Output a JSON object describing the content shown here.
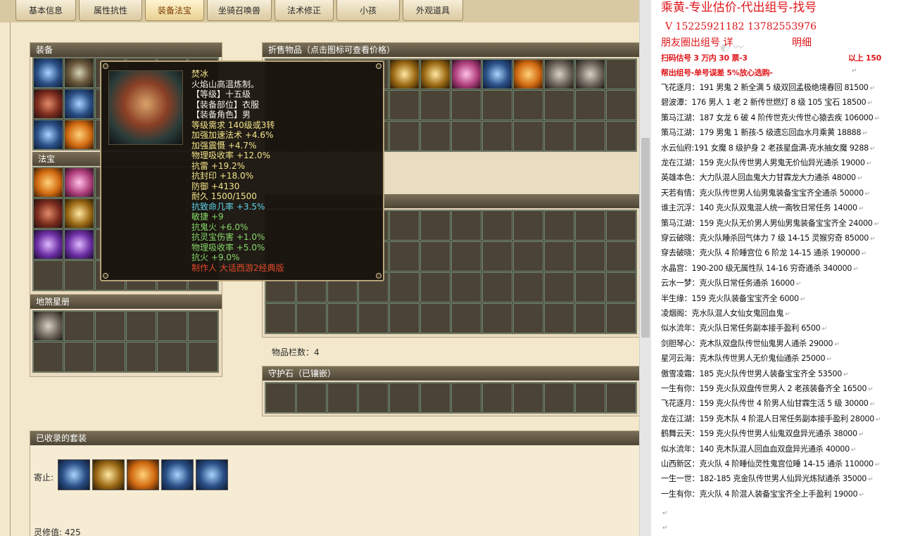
{
  "tabs": [
    {
      "label": "基本信息"
    },
    {
      "label": "属性抗性"
    },
    {
      "label": "装备法宝"
    },
    {
      "label": "坐骑召唤兽"
    },
    {
      "label": "法术修正"
    },
    {
      "label": "小孩"
    },
    {
      "label": "外观道具"
    }
  ],
  "active_tab": "装备法宝",
  "panels": {
    "equipment": "装备",
    "treasure": "法宝",
    "star_book": "地煞星册",
    "sell_items": "折售物品（点击图标可查看价格）",
    "guard_stone": "守护石（已镶嵌）",
    "collected_sets": "已收录的套装"
  },
  "item_slots_label": "物品栏数：4",
  "sets_row_label": "寄止:",
  "spirit_value_label": "灵修值:  425",
  "tooltip": {
    "lines": [
      {
        "text": "焚冰",
        "color": "y"
      },
      {
        "text": "火焰山高温炼制。",
        "color": "w"
      },
      {
        "text": "【等级】十五级",
        "color": "w"
      },
      {
        "text": "【装备部位】衣服",
        "color": "w"
      },
      {
        "text": "【装备角色】男",
        "color": "w"
      },
      {
        "text": "等级需求 140级或3转",
        "color": "y"
      },
      {
        "text": "加强加速法术 +4.6%",
        "color": "y"
      },
      {
        "text": "加强震慑 +4.7%",
        "color": "y"
      },
      {
        "text": "物理吸收率 +12.0%",
        "color": "y"
      },
      {
        "text": "抗雷 +19.2%",
        "color": "y"
      },
      {
        "text": "抗封印 +18.0%",
        "color": "y"
      },
      {
        "text": "防御 +4130",
        "color": "y"
      },
      {
        "text": "耐久 1500/1500",
        "color": "y"
      },
      {
        "text": "抗致命几率 +3.5%",
        "color": "c"
      },
      {
        "text": "敏捷 +9",
        "color": "g"
      },
      {
        "text": "抗鬼火 +6.0%",
        "color": "g"
      },
      {
        "text": "抗灵宝伤害 +1.0%",
        "color": "g"
      },
      {
        "text": "物理吸收率 +5.0%",
        "color": "g"
      },
      {
        "text": "抗火 +9.0%",
        "color": "g"
      },
      {
        "text": "制作人 大话西游2经典版",
        "color": "r"
      }
    ]
  },
  "ad": {
    "title": "乘黄-专业估价-代出组号-找号",
    "phone": "V 15225921182   13782553976",
    "line2": "朋友圈出组号   详",
    "line2b": "明细",
    "bold1": "扫码估号 3 万内 30 票-3",
    "bold1b": "以上 150",
    "bold2": "帮出组号-单号误差 5%放心选购-",
    "return_mark": "↵",
    "listings": [
      "飞花逐月：191 男鬼 2 新全满 5 级双回孟极绝境春回 81500",
      "碧波潭：176 男人 1 老 2 新传世燃灯 8 级 105 宝石 18500",
      "策马江湖：187 女龙 6 破 4 阶传世克火传世心猿去疾 106000",
      "策马江湖：179 男鬼 1 新孩-5 级遗忘回血水月乘黄 18888",
      "水云仙府:191 女魔 8 级护身 2 老孩星盘满-克水抽女魔 9288",
      "龙在江湖：159 克火队传世男人男鬼无价仙异光通杀 19000",
      "英雄本色：大力队混人回血鬼大力甘霖龙大力通杀 48000",
      "天若有情：克火队传世男人仙男鬼装备宝宝齐全通杀 50000",
      "谁主沉浮：140 克火队双鬼混人统一斋牧日常任务 14000",
      "策马江湖：159 克火队无价男人男仙男鬼装备宝宝齐全 24000",
      "穿云破晓：克火队睡杀回气体力 7 级 14-15 灵猴穷奇 85000",
      "穿去破晓：克火队 4 阶睡宫位 6 阶龙 14-15 通杀 190000",
      "水晶宫：190-200 级无属性队 14-16 穷奇通杀 340000",
      "云水一梦：克火队日常任务通杀 16000",
      "半生缘：159 克火队装备宝宝齐全 6000",
      "凌烟阁：克水队混人女仙女鬼回血鬼",
      "似水流年：克火队日常任务副本接手盈利 6500",
      "剑胆琴心：克木队双盘队传世仙鬼男人通杀 29000",
      "星河云海：克木队传世男人无价鬼仙通杀 25000",
      "傲雪凌霜：185 克火队传世男人装备宝宝齐全 53500",
      "一生有你：159 克火队双盘传世男人 2 老孩装备齐全 16500",
      "飞花逐月：159 克火队传世 4 阶男人仙甘霖生活 5 级 30000",
      "龙在江湖：159 克木队 4 阶混人日常任务副本接手盈利 28000",
      "鹤舞云天：159 克火队传世男人仙鬼双盘异光通杀 38000",
      "似水流年：140 克木队混人回血血双盘异光通杀 40000",
      "山西新区：克火队 4 阶睡仙灵性鬼宫位睡 14-15 通杀 110000",
      "一生一世：182-185 克金队传世男人仙异光炼狱通杀 35000",
      "一生有你：克火队 4 阶混人装备宝宝齐全上手盈利 19000"
    ]
  }
}
